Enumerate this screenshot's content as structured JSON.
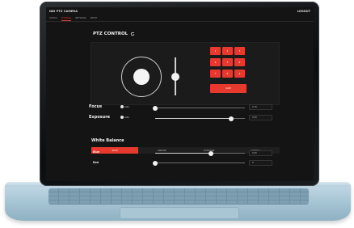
{
  "app": {
    "title": "NDI PTZ CAMERA",
    "logout_label": "LOGOUT"
  },
  "tabs": [
    {
      "label": "STATUS",
      "active": false
    },
    {
      "label": "CONTROL",
      "active": true
    },
    {
      "label": "NETWORK",
      "active": false
    },
    {
      "label": "SETUP",
      "active": false
    }
  ],
  "ptz": {
    "title": "PTZ CONTROL",
    "presets": [
      "1",
      "2",
      "3",
      "4",
      "5",
      "6",
      "7",
      "8",
      "9"
    ],
    "save_label": "SAVE"
  },
  "focus": {
    "label": "Focus",
    "auto_label": "Auto",
    "level": 0.0,
    "value": "0.15"
  },
  "exposure": {
    "label": "Exposure",
    "auto_label": "Auto",
    "level": 0.85,
    "value": "0.50"
  },
  "white_balance": {
    "title": "White Balance",
    "modes": [
      {
        "label": "AUTO",
        "active": true
      },
      {
        "label": "INDOOR",
        "active": false
      },
      {
        "label": "OUTDOOR",
        "active": false
      },
      {
        "label": "MANUAL",
        "active": false
      }
    ],
    "blue": {
      "label": "Blue",
      "level": 0.62,
      "value": "0.50"
    },
    "red": {
      "label": "Red",
      "level": 0.0,
      "value": "0"
    }
  },
  "colors": {
    "accent": "#e63a2e",
    "background": "#141414"
  }
}
